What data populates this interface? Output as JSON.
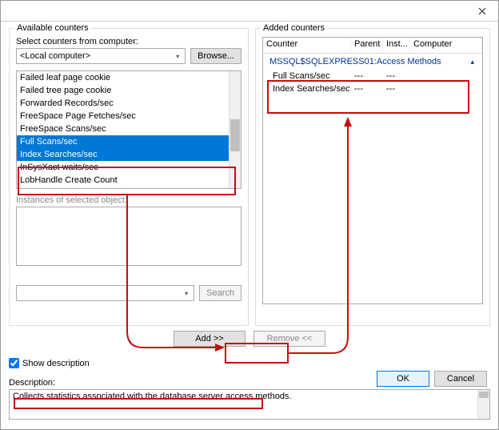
{
  "titlebar": {
    "close_tooltip": "Close"
  },
  "left": {
    "group_label": "Available counters",
    "computer_label": "Select counters from computer:",
    "computer_value": "<Local computer>",
    "browse_label": "Browse...",
    "items": [
      {
        "label": "Failed leaf page cookie",
        "selected": false
      },
      {
        "label": "Failed tree page cookie",
        "selected": false
      },
      {
        "label": "Forwarded Records/sec",
        "selected": false
      },
      {
        "label": "FreeSpace Page Fetches/sec",
        "selected": false
      },
      {
        "label": "FreeSpace Scans/sec",
        "selected": false
      },
      {
        "label": "Full Scans/sec",
        "selected": true
      },
      {
        "label": "Index Searches/sec",
        "selected": true
      },
      {
        "label": "InSysXact waits/sec",
        "selected": false
      },
      {
        "label": "LobHandle Create Count",
        "selected": false
      }
    ],
    "instances_label": "Instances of selected object:",
    "search_label": "Search"
  },
  "right": {
    "group_label": "Added counters",
    "headers": {
      "counter": "Counter",
      "parent": "Parent",
      "inst": "Inst...",
      "computer": "Computer"
    },
    "group_row": "MSSQL$SQLEXPRESS01:Access Methods",
    "rows": [
      {
        "counter": "Full Scans/sec",
        "parent": "---",
        "inst": "---",
        "computer": ""
      },
      {
        "counter": "Index Searches/sec",
        "parent": "---",
        "inst": "---",
        "computer": ""
      }
    ]
  },
  "buttons": {
    "add": "Add >>",
    "remove": "Remove <<",
    "ok": "OK",
    "cancel": "Cancel"
  },
  "show_desc_label": "Show description",
  "description_label": "Description:",
  "description_text": "Collects statistics associated with the database server access methods."
}
